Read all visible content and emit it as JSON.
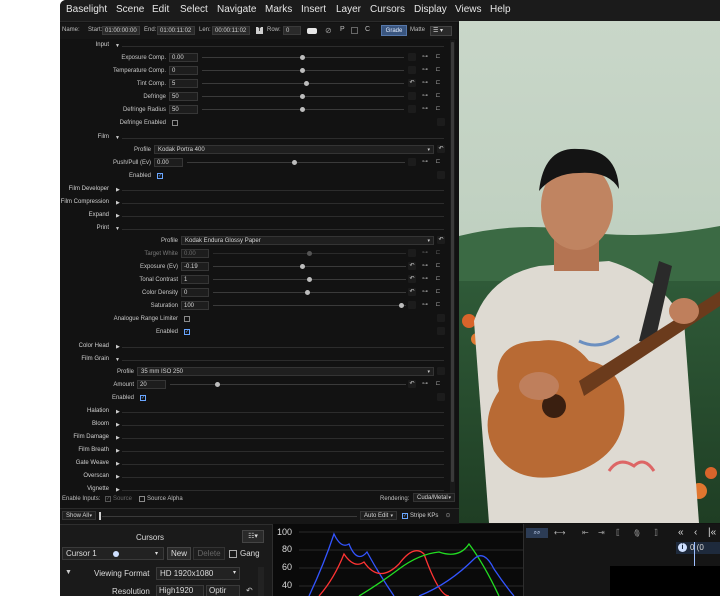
{
  "menu": [
    "Baselight",
    "Scene",
    "Edit",
    "Select",
    "Navigate",
    "Marks",
    "Insert",
    "Layer",
    "Cursors",
    "Display",
    "Views",
    "Help"
  ],
  "toolbar": {
    "name_label": "Name:",
    "start_label": "Start:",
    "start_value": "01:00:00:00",
    "end_label": "End:",
    "end_value": "01:00:11:02",
    "len_label": "Len:",
    "len_value": "00:00:11:02",
    "row_label": "Row:",
    "row_value": "0",
    "p_label": "P",
    "c_label": "C",
    "grade_label": "Grade",
    "matte_label": "Matte"
  },
  "panel": {
    "input": {
      "title": "Input",
      "rows": [
        {
          "label": "Exposure Comp.",
          "value": "0.00",
          "pos": 0.5
        },
        {
          "label": "Temperature Comp.",
          "value": "0",
          "pos": 0.5
        },
        {
          "label": "Tint Comp.",
          "value": "5",
          "pos": 0.52
        },
        {
          "label": "Defringe",
          "value": "50",
          "pos": 0.5
        },
        {
          "label": "Defringe Radius",
          "value": "50",
          "pos": 0.5
        }
      ],
      "defringe_enabled": "Defringe Enabled"
    },
    "film": {
      "title": "Film",
      "profile_label": "Profile",
      "profile_value": "Kodak Portra 400",
      "pushpull_label": "Push/Pull (Ev)",
      "pushpull_value": "0.00",
      "enabled_label": "Enabled"
    },
    "collapsed_a": [
      "Film Developer",
      "Film Compression",
      "Expand"
    ],
    "print": {
      "title": "Print",
      "profile_label": "Profile",
      "profile_value": "Kodak Endura Glossy Paper",
      "rows": [
        {
          "label": "Target White",
          "value": "0.00",
          "pos": 0.5,
          "dim": true
        },
        {
          "label": "Exposure (Ev)",
          "value": "-0.19",
          "pos": 0.48
        },
        {
          "label": "Tonal Contrast",
          "value": "1",
          "pos": 0.5
        },
        {
          "label": "Color Density",
          "value": "0",
          "pos": 0.5
        },
        {
          "label": "Saturation",
          "value": "100",
          "pos": 0.98
        }
      ],
      "analogue_label": "Analogue Range Limiter",
      "enabled_label": "Enabled"
    },
    "color_head": "Color Head",
    "grain": {
      "title": "Film Grain",
      "profile_label": "Profile",
      "profile_value": "35 mm ISO 250",
      "amount_label": "Amount",
      "amount_value": "20",
      "amount_pos": 0.2,
      "enabled_label": "Enabled"
    },
    "collapsed_b": [
      "Halation",
      "Bloom",
      "Film Damage",
      "Film Breath",
      "Gate Weave",
      "Overscan",
      "Vignette"
    ],
    "footer": {
      "enable_inputs": "Enable Inputs:",
      "source": "Source",
      "source_alpha": "Source Alpha",
      "rendering_label": "Rendering:",
      "rendering_value": "Cuda/Metal"
    }
  },
  "bottom": {
    "show_all": "Show All",
    "auto_edit": "Auto Edit",
    "stripe_kps": "Stripe KPs"
  },
  "cursors": {
    "title": "Cursors",
    "cursor_value": "Cursor 1",
    "new_label": "New",
    "delete_label": "Delete",
    "gang_label": "Gang",
    "viewing_format_label": "Viewing Format",
    "viewing_format_value": "HD 1920x1080",
    "resolution_label": "Resolution",
    "resolution_value": "High1920",
    "option_value": "Optir"
  },
  "histogram": {
    "ticks": [
      "100",
      "80",
      "60",
      "40"
    ]
  },
  "timeline": {
    "frame_value": "0 (0"
  }
}
